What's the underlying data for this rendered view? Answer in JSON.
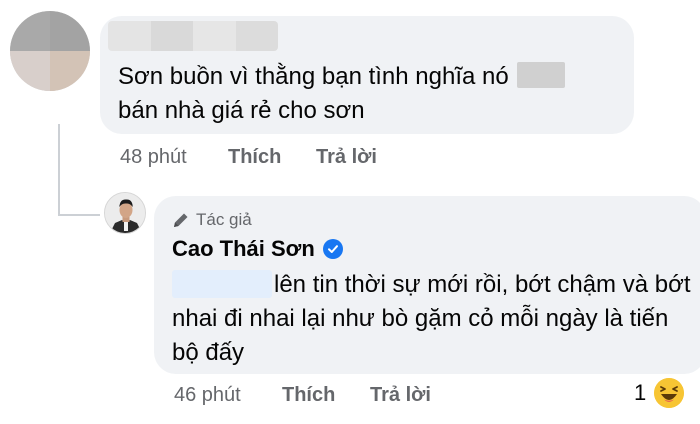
{
  "comment": {
    "text_before": "Sơn buồn vì thằng bạn tình nghĩa nó",
    "text_after": "bán nhà giá rẻ cho sơn",
    "time": "48 phút",
    "like_label": "Thích",
    "reply_label": "Trả lời"
  },
  "reply": {
    "badge": "Tác giả",
    "author": "Cao Thái Sơn",
    "text": "lên tin thời sự mới rồi, bớt chậm và bớt nhai đi nhai lại như bò gặm cỏ mỗi ngày là tiến bộ đấy",
    "time": "46 phút",
    "like_label": "Thích",
    "reply_label": "Trả lời",
    "reaction_count": "1",
    "reaction_icon": "haha-reaction-icon"
  },
  "colors": {
    "bubble": "#f0f2f5",
    "meta": "#65676b",
    "verified": "#1877f2",
    "thread_line": "#ccd0d5"
  }
}
